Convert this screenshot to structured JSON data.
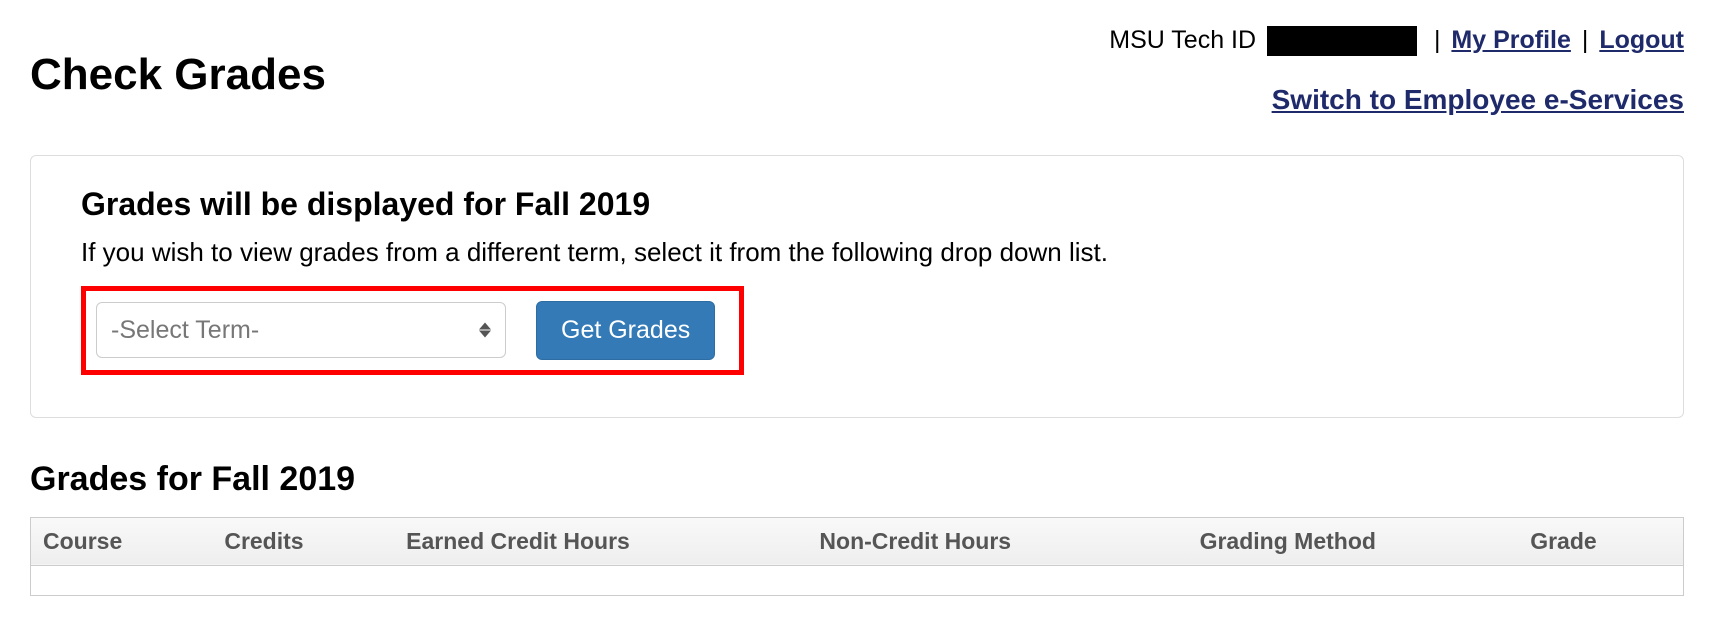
{
  "header": {
    "page_title": "Check Grades",
    "tech_id_label": "MSU Tech ID",
    "tech_id_value": "",
    "sep1": " | ",
    "my_profile": "My Profile",
    "sep2": " | ",
    "logout": "Logout",
    "switch_link": "Switch to Employee e-Services"
  },
  "panel": {
    "heading": "Grades will be displayed for Fall 2019",
    "subtext": "If you wish to view grades from a different term, select it from the following drop down list.",
    "select_placeholder": "-Select Term-",
    "button_label": "Get Grades"
  },
  "grades_section": {
    "title": "Grades for Fall 2019",
    "columns": {
      "course": "Course",
      "credits": "Credits",
      "earned": "Earned Credit Hours",
      "noncredit": "Non-Credit Hours",
      "method": "Grading Method",
      "grade": "Grade"
    }
  }
}
